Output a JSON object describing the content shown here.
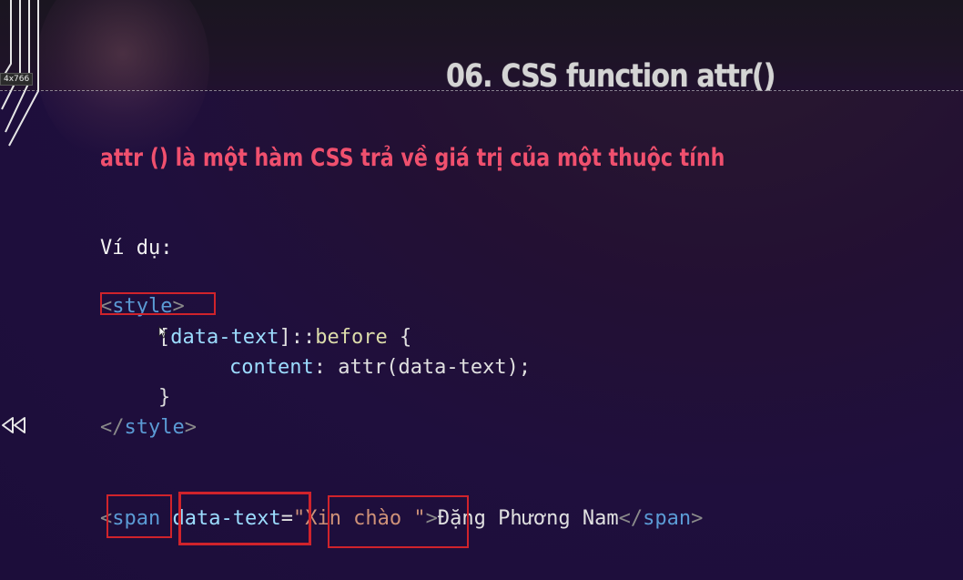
{
  "overlay": {
    "size_badge": "4x766"
  },
  "slide": {
    "title": "06. CSS function attr()",
    "subtitle": "attr () là một hàm CSS trả về giá trị của một thuộc tính",
    "example_label": "Ví dụ:"
  },
  "code": {
    "style_open_lt": "<",
    "style_open_tag": "style",
    "style_open_gt": ">",
    "selector_open": "[",
    "selector_attr": "data-text",
    "selector_close": "]",
    "pseudo_sep": "::",
    "pseudo": "before",
    "brace_open": " {",
    "prop": "content",
    "colon": ": ",
    "func": "attr(data-text);",
    "brace_close": "}",
    "style_close_lt": "</",
    "style_close_tag": "style",
    "style_close_gt": ">",
    "span_lt": "<",
    "span_tag": "span",
    "span_space": " ",
    "span_attr": "data-text",
    "span_eq": "=",
    "span_value": "\"Xin chào \"",
    "span_gt": ">",
    "span_text": "Đặng Phương Nam",
    "span_close_lt": "</",
    "span_close_tag": "span",
    "span_close_gt": ">"
  },
  "icons": [
    "circuit-decoration-icon",
    "cursor-icon",
    "rewind-icon"
  ],
  "colors": {
    "background": "#1f0f3d",
    "subtitle": "#f0506e",
    "highlight_box": "#d0232b",
    "tag": "#5b9bd5",
    "attribute": "#9cdcfe",
    "string": "#ce9178"
  }
}
